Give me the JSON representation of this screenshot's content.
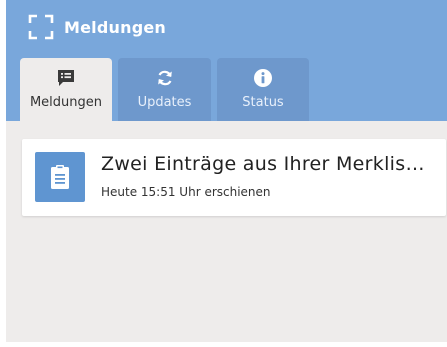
{
  "header": {
    "app_title": "Meldungen",
    "icon": "expand-corners-icon",
    "background_color": "#79a7db"
  },
  "tabs": [
    {
      "label": "Meldungen",
      "icon": "message-list-icon",
      "active": true
    },
    {
      "label": "Updates",
      "icon": "sync-icon",
      "active": false
    },
    {
      "label": "Status",
      "icon": "info-icon",
      "active": false
    }
  ],
  "notifications": [
    {
      "icon": "clipboard-icon",
      "title": "Zwei Einträge aus Ihrer Merklis…",
      "subtitle": "Heute 15:51 Uhr erschienen"
    }
  ],
  "colors": {
    "accent": "#5f95d1",
    "content_background": "#eeeceb"
  }
}
